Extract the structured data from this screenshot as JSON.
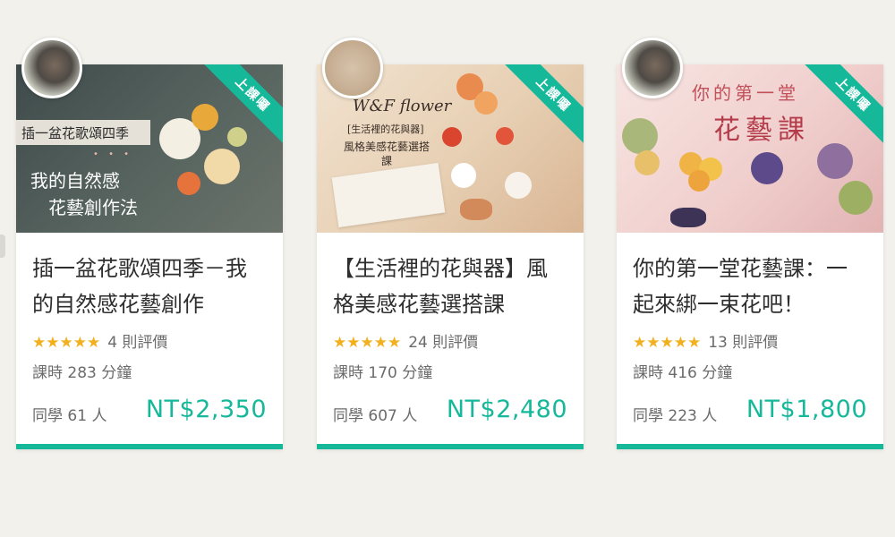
{
  "courses": [
    {
      "badge": "上課囉",
      "title": "插一盆花歌頌四季－我的自然感花藝創作",
      "stars": "★★★★★",
      "reviews": "4 則評價",
      "duration": "課時 283 分鐘",
      "students": "同學 61 人",
      "price": "NT$2,350",
      "thumb": {
        "line1": "插一盆花歌頌四季",
        "dots": "• • •",
        "line2": "我的自然感",
        "line3": "花藝創作法"
      }
    },
    {
      "badge": "上課囉",
      "title": "【生活裡的花與器】風格美感花藝選搭課",
      "stars": "★★★★★",
      "reviews": "24 則評價",
      "duration": "課時 170 分鐘",
      "students": "同學 607 人",
      "price": "NT$2,480",
      "thumb": {
        "script": "W&F flower",
        "sub": "[生活裡的花與器]",
        "body": "風格美感花藝選搭課"
      }
    },
    {
      "badge": "上課囉",
      "title": "你的第一堂花藝課：一起來綁一束花吧！",
      "stars": "★★★★★",
      "reviews": "13 則評價",
      "duration": "課時 416 分鐘",
      "students": "同學 223 人",
      "price": "NT$1,800",
      "thumb": {
        "top": "你的第一堂",
        "big": "花藝課"
      }
    }
  ],
  "colors": {
    "accent": "#16b89a",
    "star": "#f2b01e",
    "background": "#f2f1ec"
  }
}
